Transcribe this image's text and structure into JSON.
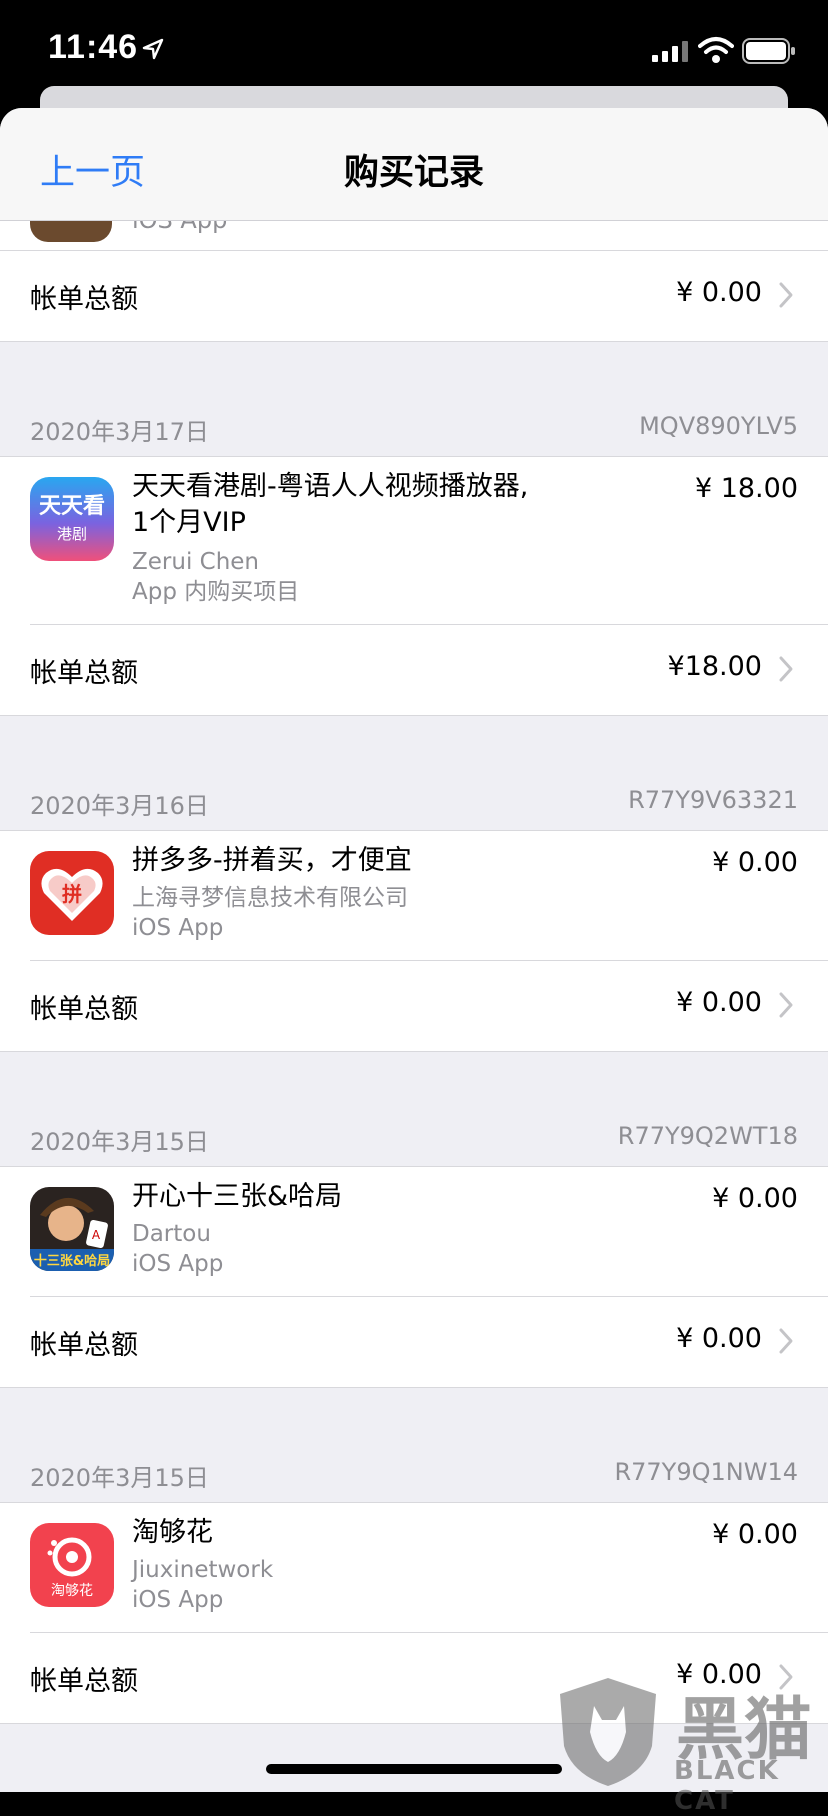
{
  "status": {
    "time": "11:46"
  },
  "nav": {
    "back": "上一页",
    "title": "购买记录"
  },
  "top_fragment": {
    "text": "iOS App"
  },
  "total_label": "帐单总额",
  "top_total": "¥ 0.00",
  "sections": [
    {
      "date": "2020年3月17日",
      "id": "MQV890YLV5",
      "item": {
        "icon": "tiantiankan-app-icon",
        "title": "天天看港剧-粤语人人视频播放器, 1个月VIP",
        "developer": "Zerui Chen",
        "kind": "App 内购买项目",
        "price": "¥ 18.00",
        "icon_text": {
          "line1": "天天看",
          "line2": "港剧"
        }
      },
      "total": "¥18.00"
    },
    {
      "date": "2020年3月16日",
      "id": "R77Y9V63321",
      "item": {
        "icon": "pinduoduo-app-icon",
        "title": "拼多多-拼着买，才便宜",
        "developer": "上海寻梦信息技术有限公司",
        "kind": "iOS App",
        "price": "¥ 0.00",
        "icon_text": {
          "line1": "拼"
        }
      },
      "total": "¥ 0.00"
    },
    {
      "date": "2020年3月15日",
      "id": "R77Y9Q2WT18",
      "item": {
        "icon": "kaixin-card-game-icon",
        "title": "开心十三张&哈局",
        "developer": "Dartou",
        "kind": "iOS App",
        "price": "¥ 0.00",
        "icon_text": {
          "line1": "十三张&哈局"
        }
      },
      "total": "¥ 0.00"
    },
    {
      "date": "2020年3月15日",
      "id": "R77Y9Q1NW14",
      "item": {
        "icon": "taogouhua-app-icon",
        "title": "淘够花",
        "developer": "Jiuxinetwork",
        "kind": "iOS App",
        "price": "¥ 0.00",
        "icon_text": {
          "line1": "淘够花"
        }
      },
      "total": "¥ 0.00"
    }
  ],
  "watermark": {
    "cn": "黑猫",
    "en": "BLACK CAT"
  },
  "colors": {
    "link": "#2f7cf6",
    "secondary_text": "#8e8e93",
    "background": "#efeff4"
  }
}
